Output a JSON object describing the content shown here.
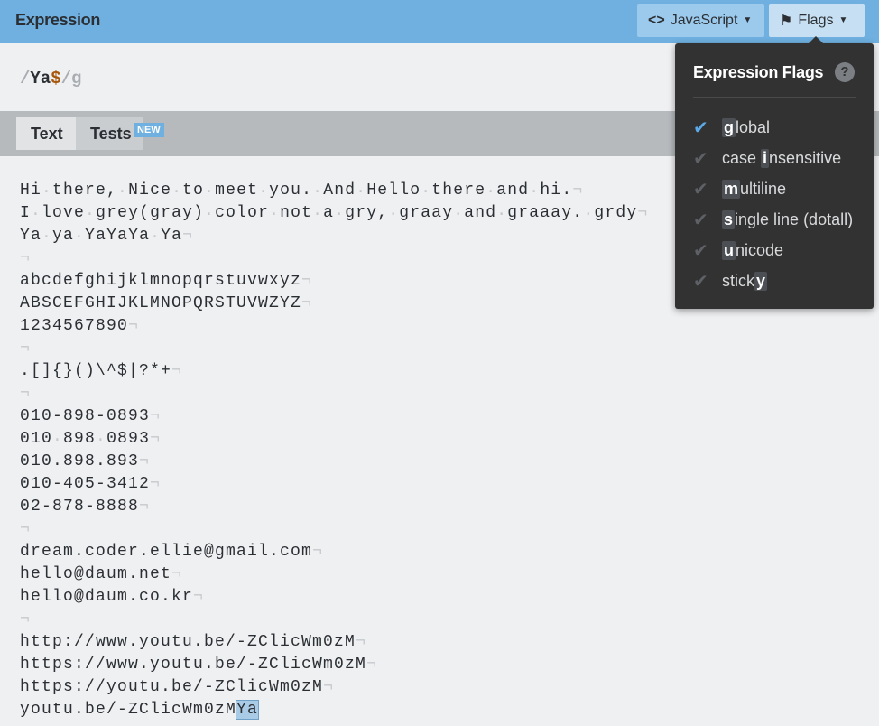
{
  "header": {
    "title": "Expression",
    "language_label": "JavaScript",
    "flags_label": "Flags"
  },
  "expression": {
    "open": "/",
    "literal": "Ya",
    "anchor": "$",
    "close": "/",
    "flags": "g"
  },
  "tabs": [
    {
      "label": "Text"
    },
    {
      "label": "Tests",
      "badge": "NEW"
    }
  ],
  "text_lines": [
    "Hi there, Nice to meet you. And Hello there and hi.",
    "I love grey(gray) color not a gry, graay and graaay. grdy",
    "Ya ya YaYaYa Ya",
    "",
    "abcdefghijklmnopqrstuvwxyz",
    "ABSCEFGHIJKLMNOPQRSTUVWZYZ",
    "1234567890",
    "",
    ".[]{}()\\^$|?*+",
    "",
    "010-898-0893",
    "010 898 0893",
    "010.898.893",
    "010-405-3412",
    "02-878-8888",
    "",
    "dream.coder.ellie@gmail.com",
    "hello@daum.net",
    "hello@daum.co.kr",
    "",
    "http://www.youtu.be/-ZClicWm0zM",
    "https://www.youtu.be/-ZClicWm0zM",
    "https://youtu.be/-ZClicWm0zM"
  ],
  "last_line": {
    "text": "youtu.be/-ZClicWm0zM",
    "match": "Ya"
  },
  "flags_popup": {
    "title": "Expression Flags",
    "help": "?",
    "items": [
      {
        "pre": "",
        "key": "g",
        "post": "lobal",
        "checked": true
      },
      {
        "pre": "case ",
        "key": "i",
        "post": "nsensitive",
        "checked": false
      },
      {
        "pre": "",
        "key": "m",
        "post": "ultiline",
        "checked": false
      },
      {
        "pre": "",
        "key": "s",
        "post": "ingle line (dotall)",
        "checked": false
      },
      {
        "pre": "",
        "key": "u",
        "post": "nicode",
        "checked": false
      },
      {
        "pre": "stick",
        "key": "y",
        "post": "",
        "checked": false
      }
    ]
  },
  "colors": {
    "accent": "#6fb0e0",
    "checked": "#5aa9e6",
    "anchor": "#a6580c",
    "match": "#a9cbe6"
  }
}
